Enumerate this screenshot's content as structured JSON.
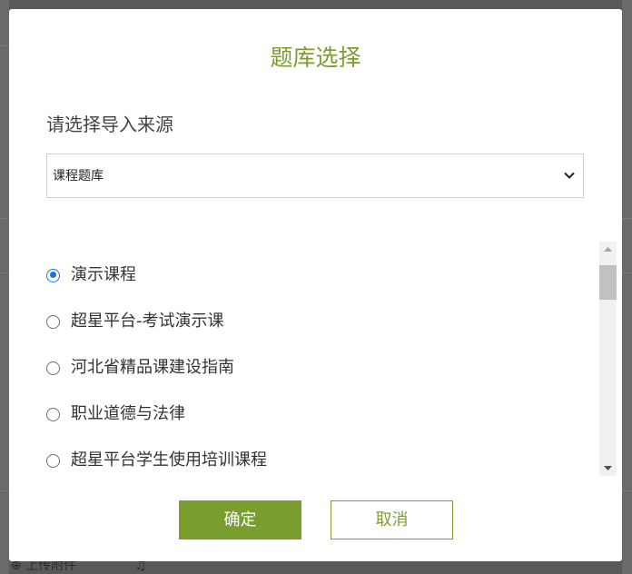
{
  "dialog": {
    "title": "题库选择",
    "source_label": "请选择导入来源",
    "select": {
      "value": "课程题库"
    },
    "items": [
      {
        "label": "演示课程",
        "checked": true
      },
      {
        "label": "超星平台-考试演示课",
        "checked": false
      },
      {
        "label": "河北省精品课建设指南",
        "checked": false
      },
      {
        "label": "职业道德与法律",
        "checked": false
      },
      {
        "label": "超星平台学生使用培训课程",
        "checked": false
      }
    ],
    "confirm_label": "确定",
    "cancel_label": "取消"
  },
  "background": {
    "bottom_toolbar_text": "上传附件"
  },
  "colors": {
    "accent": "#7a9e2e",
    "radio_selected": "#1a73e8",
    "overlay": "#595959"
  }
}
